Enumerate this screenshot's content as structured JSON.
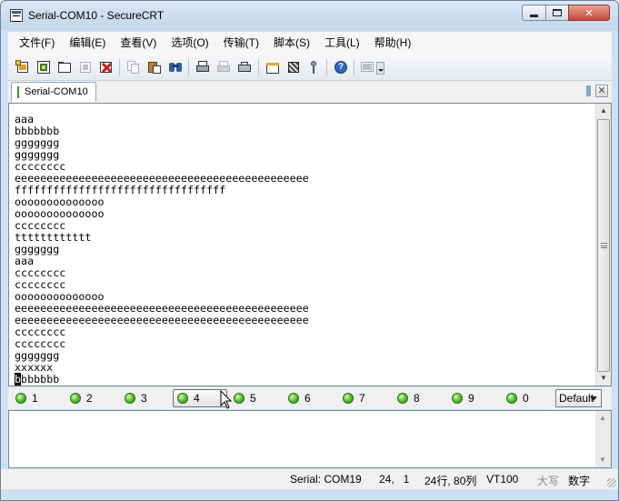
{
  "window": {
    "title": "Serial-COM10 - SecureCRT"
  },
  "menu": [
    "文件(F)",
    "编辑(E)",
    "查看(V)",
    "选项(O)",
    "传输(T)",
    "脚本(S)",
    "工具(L)",
    "帮助(H)"
  ],
  "toolbar_icons": [
    "connect-icon",
    "quick-connect-icon",
    "connect-in-tab-icon",
    "reconnect-icon",
    "disconnect-icon",
    "copy-icon",
    "paste-icon",
    "find-icon",
    "print-icon",
    "print-selection-icon",
    "print-setup-icon",
    "session-options-icon",
    "global-options-icon",
    "key-icon",
    "help-icon",
    "screen-icon"
  ],
  "tab": {
    "label": "Serial-COM10",
    "accent": "#2e9b37"
  },
  "terminal": {
    "lines": [
      "aaa",
      "bbbbbbb",
      "ggggggg",
      "ggggggg",
      "cccccccc",
      "eeeeeeeeeeeeeeeeeeeeeeeeeeeeeeeeeeeeeeeeeeeeee",
      "fffffffffffffffffffffffffffffffff",
      "oooooooooooooo",
      "oooooooooooooo",
      "cccccccc",
      "tttttttttttt",
      "ggggggg",
      "aaa",
      "cccccccc",
      "cccccccc",
      "oooooooooooooo",
      "eeeeeeeeeeeeeeeeeeeeeeeeeeeeeeeeeeeeeeeeeeeeee",
      "eeeeeeeeeeeeeeeeeeeeeeeeeeeeeeeeeeeeeeeeeeeeee",
      "cccccccc",
      "cccccccc",
      "ggggggg",
      "xxxxxx"
    ],
    "cursor_line": {
      "cursor_char": "b",
      "rest": "bbbbbb"
    }
  },
  "button_bar": {
    "buttons": [
      "1",
      "2",
      "3",
      "4",
      "5",
      "6",
      "7",
      "8",
      "9",
      "0"
    ],
    "active": "4",
    "led_color": "#5cc43a",
    "dropdown_value": "Default"
  },
  "status": {
    "connection": "Serial: COM19",
    "position": "24,   1",
    "size": "24行, 80列",
    "emulation": "VT100",
    "caps": "大写",
    "num": "数字"
  }
}
